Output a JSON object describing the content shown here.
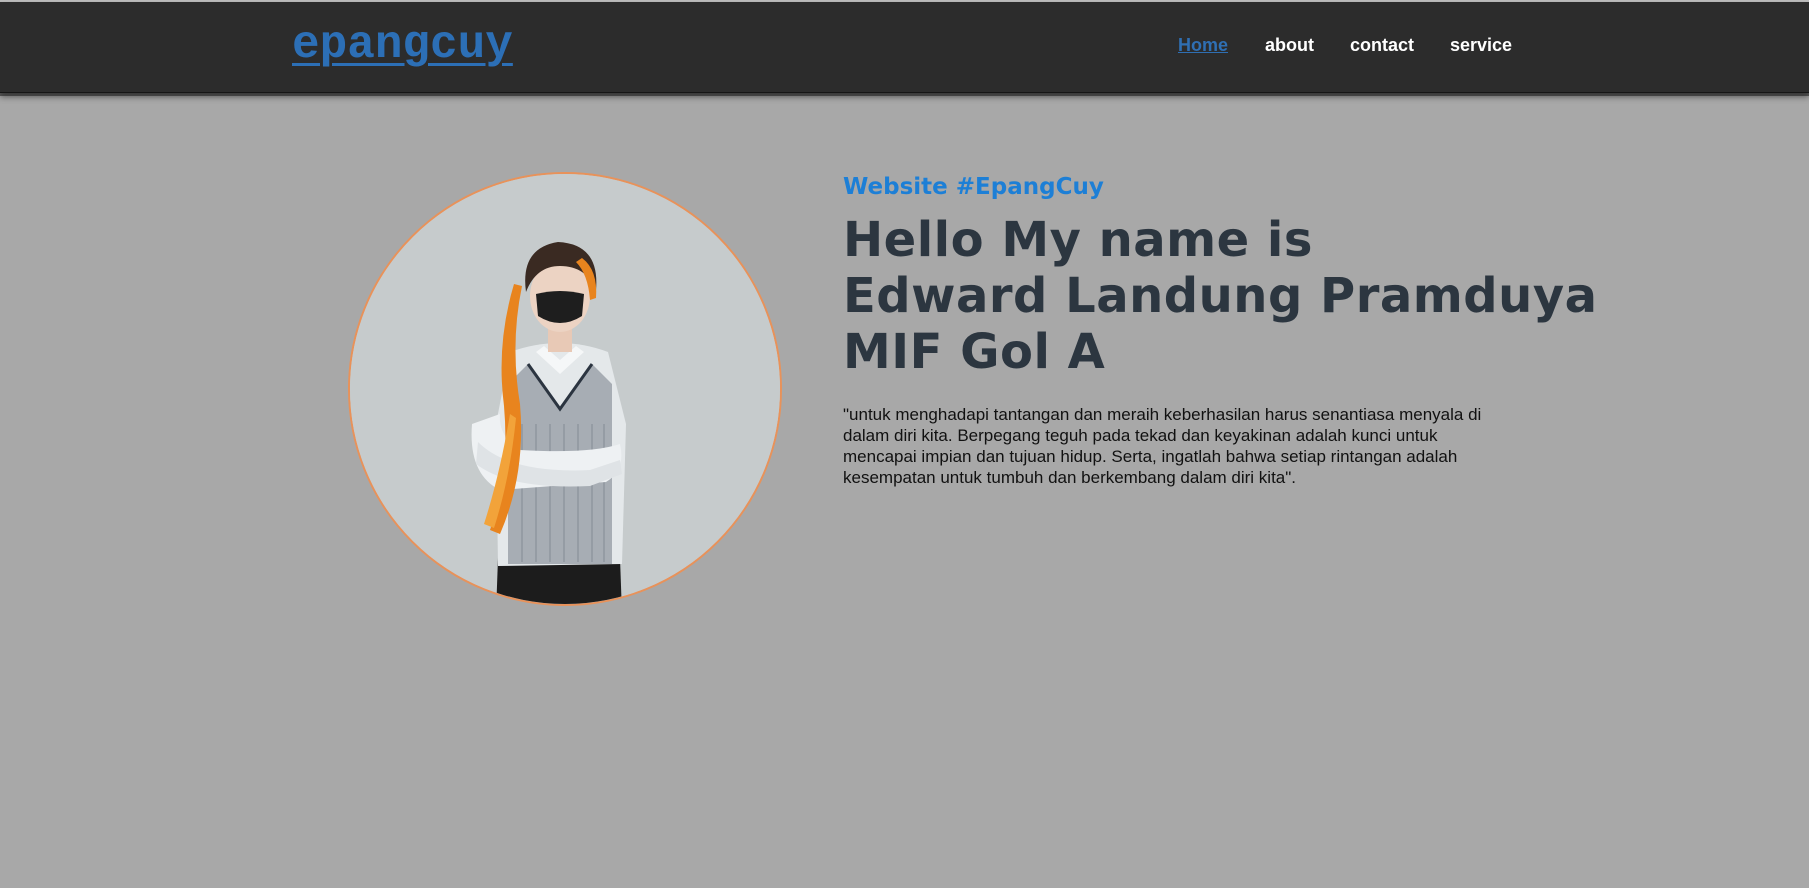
{
  "colors": {
    "page_background": "#a8a8a8",
    "navbar_background": "#2c2c2c",
    "logo": "#2c6fb6",
    "nav_active": "#2f6fb3",
    "nav_text": "#ffffff",
    "subtitle": "#1d7fd6",
    "headline": "#2c3640",
    "avatar_border": "#e8925a"
  },
  "header": {
    "logo": "epangcuy",
    "nav": [
      {
        "label": "Home",
        "active": true
      },
      {
        "label": "about",
        "active": false
      },
      {
        "label": "contact",
        "active": false
      },
      {
        "label": "service",
        "active": false
      }
    ]
  },
  "hero": {
    "subtitle": "Website #EpangCuy",
    "headline_lines": [
      "Hello My name is",
      "Edward Landung Pramduya",
      "MIF Gol A"
    ],
    "quote": "\"untuk menghadapi tantangan dan meraih keberhasilan harus senantiasa menyala di dalam diri kita. Berpegang teguh pada tekad dan keyakinan adalah kunci untuk mencapai impian dan tujuan hidup. Serta, ingatlah bahwa setiap rintangan adalah kesempatan untuk tumbuh dan berkembang dalam diri kita\".",
    "avatar_icon": "profile-photo"
  }
}
